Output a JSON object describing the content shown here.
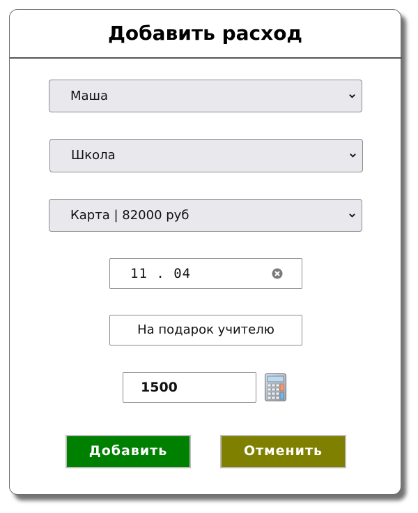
{
  "form": {
    "title": "Добавить расход",
    "person_select": {
      "value": "Маша"
    },
    "category_select": {
      "value": "Школа"
    },
    "account_select": {
      "value": "Карта | 82000 руб"
    },
    "date_field": {
      "value": "11.04"
    },
    "note_field": {
      "value": "На подарок учителю"
    },
    "amount_field": {
      "value": "1500"
    },
    "buttons": {
      "add_label": "Добавить",
      "cancel_label": "Отменить"
    }
  },
  "icons": {
    "select_arrow": "chevron-down-icon",
    "clear": "clear-icon",
    "calculator": "calculator-icon"
  },
  "colors": {
    "add_button": "#008000",
    "cancel_button": "#808000",
    "select_background": "#e9e8ed"
  }
}
